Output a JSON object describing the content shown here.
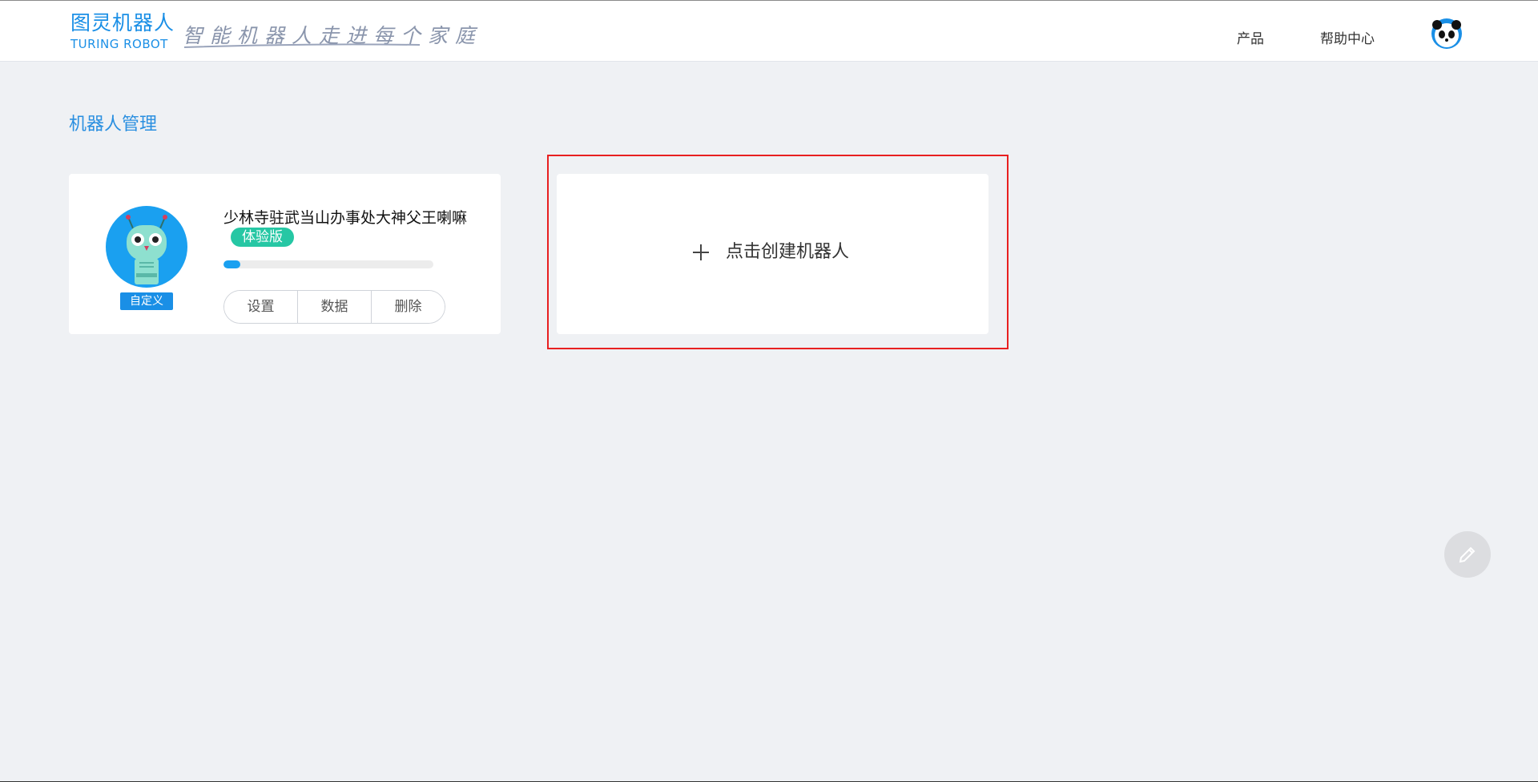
{
  "header": {
    "logo_cn": "图灵机器人",
    "logo_en": "TURING ROBOT",
    "slogan": "智能机器人走进每个家庭",
    "nav": [
      {
        "label": "产品"
      },
      {
        "label": "帮助中心"
      }
    ],
    "avatar_icon": "panda-avatar-icon"
  },
  "page": {
    "title": "机器人管理"
  },
  "robots": [
    {
      "name": "少林寺驻武当山办事处大神父王喇嘛",
      "badge": "体验版",
      "type_label": "自定义",
      "progress_fraction": 0.08,
      "actions": [
        "设置",
        "数据",
        "删除"
      ],
      "avatar_icon": "robot-avatar-icon"
    }
  ],
  "create_card": {
    "label": "点击创建机器人",
    "icon": "plus-icon"
  },
  "floating": {
    "icon": "pencil-icon"
  },
  "colors": {
    "accent": "#1a8fe6",
    "trial_badge": "#26c7a4",
    "highlight": "#e82020",
    "background": "#eff1f4"
  }
}
